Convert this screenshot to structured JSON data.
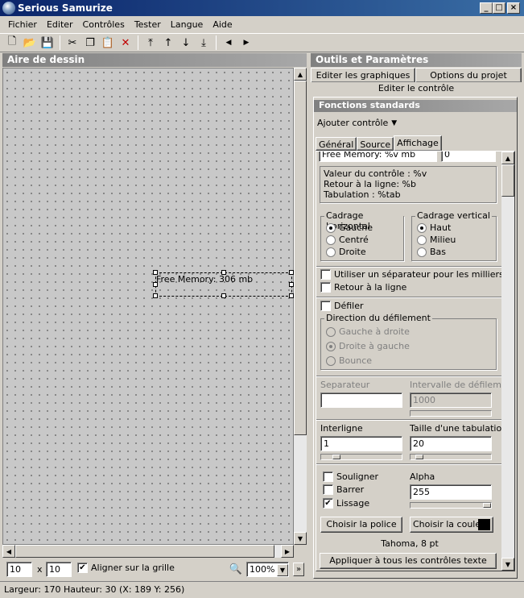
{
  "window": {
    "title": "Serious Samurize"
  },
  "menu": [
    "Fichier",
    "Editer",
    "Contrôles",
    "Tester",
    "Langue",
    "Aide"
  ],
  "left_panel": {
    "title": "Aire de dessin"
  },
  "canvas_element": {
    "text": "Free Memory: 306 mb"
  },
  "bottom": {
    "grid_x": "10",
    "x_sep": "x",
    "grid_y": "10",
    "snap_label": "Aligner sur la grille",
    "snap_checked": true,
    "zoom": "100%"
  },
  "right_panel": {
    "title": "Outils et Paramètres",
    "tabs_row1": [
      "Editer les graphiques",
      "Options du projet"
    ],
    "tab_active": "Editer le contrôle",
    "section_title": "Fonctions standards",
    "add_control": "Ajouter contrôle",
    "subtabs": [
      "Général",
      "Source",
      "Affichage"
    ],
    "format_value": "Free Memory: %v mb",
    "format_value2": "0",
    "help_lines": [
      "Valeur du contrôle : %v",
      "Retour à la ligne: %b",
      "Tabulation : %tab"
    ],
    "cadrage_h": {
      "label": "Cadrage horizontal",
      "options": [
        "Gauche",
        "Centré",
        "Droite"
      ],
      "selected": "Gauche"
    },
    "cadrage_v": {
      "label": "Cadrage vertical",
      "options": [
        "Haut",
        "Milieu",
        "Bas"
      ],
      "selected": "Haut"
    },
    "separator_check": "Utiliser un séparateur pour les milliers",
    "wrap_check": "Retour à la ligne",
    "scroll_check": "Défiler",
    "scroll_dir": {
      "label": "Direction du défilement",
      "options": [
        "Gauche à droite",
        "Droite à gauche",
        "Bounce"
      ],
      "selected": "Droite à gauche"
    },
    "separator_label": "Separateur",
    "separator_value": "",
    "interval_label": "Intervalle de défilement",
    "interval_value": "1000",
    "interline_label": "Interligne",
    "interline_value": "1",
    "tab_size_label": "Taille d'une tabulation",
    "tab_size_value": "20",
    "underline": "Souligner",
    "strike": "Barrer",
    "smooth": "Lissage",
    "alpha_label": "Alpha",
    "alpha_value": "255",
    "font_button": "Choisir la police",
    "color_button": "Choisir la couleur",
    "color_swatch": "#000000",
    "font_info": "Tahoma, 8 pt",
    "apply_all": "Appliquer à tous les contrôles texte"
  },
  "status": "Largeur: 170  Hauteur: 30  (X: 189  Y: 256)"
}
